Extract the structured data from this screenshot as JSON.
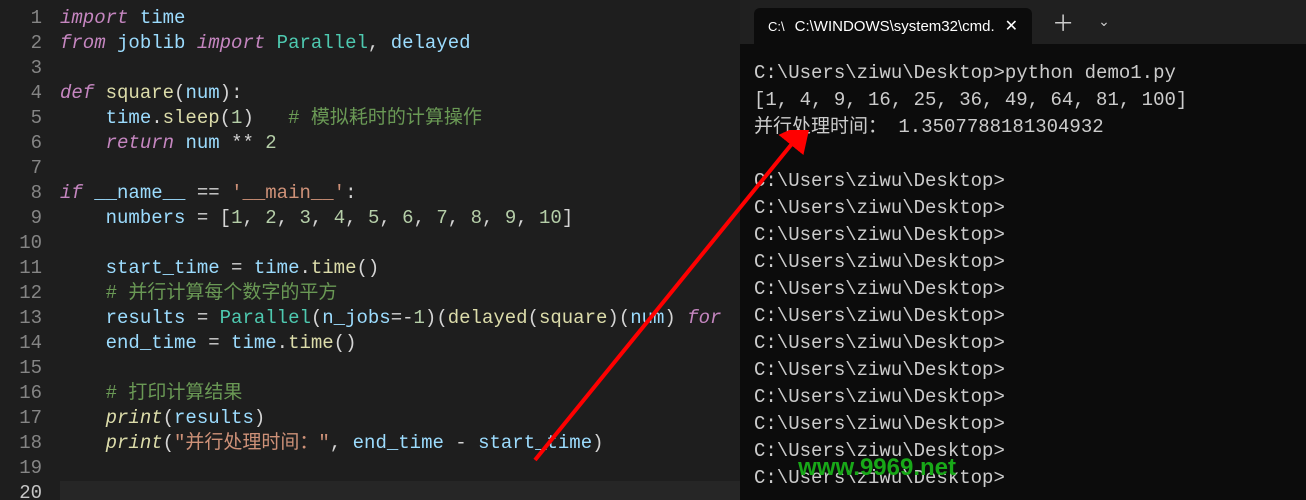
{
  "editor": {
    "line_count": 20,
    "current_line": 20,
    "lines": {
      "l1": [
        {
          "t": "import",
          "c": "kw"
        },
        {
          "t": " "
        },
        {
          "t": "time",
          "c": "var"
        }
      ],
      "l2": [
        {
          "t": "from",
          "c": "kw"
        },
        {
          "t": " "
        },
        {
          "t": "joblib",
          "c": "var"
        },
        {
          "t": " "
        },
        {
          "t": "import",
          "c": "kw"
        },
        {
          "t": " "
        },
        {
          "t": "Parallel",
          "c": "cls"
        },
        {
          "t": ", "
        },
        {
          "t": "delayed",
          "c": "var"
        }
      ],
      "l3": [],
      "l4": [
        {
          "t": "def",
          "c": "kw"
        },
        {
          "t": " "
        },
        {
          "t": "square",
          "c": "fn"
        },
        {
          "t": "(",
          "c": "p"
        },
        {
          "t": "num",
          "c": "var"
        },
        {
          "t": ")",
          "c": "p"
        },
        {
          "t": ":",
          "c": "p"
        }
      ],
      "l5": [
        {
          "t": "    "
        },
        {
          "t": "time",
          "c": "var"
        },
        {
          "t": ".",
          "c": "p"
        },
        {
          "t": "sleep",
          "c": "fn"
        },
        {
          "t": "(",
          "c": "p"
        },
        {
          "t": "1",
          "c": "num"
        },
        {
          "t": ")",
          "c": "p"
        },
        {
          "t": "   "
        },
        {
          "t": "# 模拟耗时的计算操作",
          "c": "cmt"
        }
      ],
      "l6": [
        {
          "t": "    "
        },
        {
          "t": "return",
          "c": "kw"
        },
        {
          "t": " "
        },
        {
          "t": "num",
          "c": "var"
        },
        {
          "t": " "
        },
        {
          "t": "**",
          "c": "op"
        },
        {
          "t": " "
        },
        {
          "t": "2",
          "c": "num"
        }
      ],
      "l7": [],
      "l8": [
        {
          "t": "if",
          "c": "kw"
        },
        {
          "t": " "
        },
        {
          "t": "__name__",
          "c": "dun"
        },
        {
          "t": " "
        },
        {
          "t": "==",
          "c": "op"
        },
        {
          "t": " "
        },
        {
          "t": "'__main__'",
          "c": "str"
        },
        {
          "t": ":",
          "c": "p"
        }
      ],
      "l9": [
        {
          "t": "    "
        },
        {
          "t": "numbers",
          "c": "var"
        },
        {
          "t": " "
        },
        {
          "t": "=",
          "c": "op"
        },
        {
          "t": " ["
        },
        {
          "t": "1",
          "c": "num"
        },
        {
          "t": ", "
        },
        {
          "t": "2",
          "c": "num"
        },
        {
          "t": ", "
        },
        {
          "t": "3",
          "c": "num"
        },
        {
          "t": ", "
        },
        {
          "t": "4",
          "c": "num"
        },
        {
          "t": ", "
        },
        {
          "t": "5",
          "c": "num"
        },
        {
          "t": ", "
        },
        {
          "t": "6",
          "c": "num"
        },
        {
          "t": ", "
        },
        {
          "t": "7",
          "c": "num"
        },
        {
          "t": ", "
        },
        {
          "t": "8",
          "c": "num"
        },
        {
          "t": ", "
        },
        {
          "t": "9",
          "c": "num"
        },
        {
          "t": ", "
        },
        {
          "t": "10",
          "c": "num"
        },
        {
          "t": "]"
        }
      ],
      "l10": [],
      "l11": [
        {
          "t": "    "
        },
        {
          "t": "start_time",
          "c": "var"
        },
        {
          "t": " "
        },
        {
          "t": "=",
          "c": "op"
        },
        {
          "t": " "
        },
        {
          "t": "time",
          "c": "var"
        },
        {
          "t": ".",
          "c": "p"
        },
        {
          "t": "time",
          "c": "fn"
        },
        {
          "t": "()",
          "c": "p"
        }
      ],
      "l12": [
        {
          "t": "    "
        },
        {
          "t": "# 并行计算每个数字的平方",
          "c": "cmt"
        }
      ],
      "l13": [
        {
          "t": "    "
        },
        {
          "t": "results",
          "c": "var"
        },
        {
          "t": " "
        },
        {
          "t": "=",
          "c": "op"
        },
        {
          "t": " "
        },
        {
          "t": "Parallel",
          "c": "cls"
        },
        {
          "t": "(",
          "c": "p"
        },
        {
          "t": "n_jobs",
          "c": "var"
        },
        {
          "t": "=",
          "c": "op"
        },
        {
          "t": "-",
          "c": "op"
        },
        {
          "t": "1",
          "c": "num"
        },
        {
          "t": ")(",
          "c": "p"
        },
        {
          "t": "delayed",
          "c": "fn"
        },
        {
          "t": "(",
          "c": "p"
        },
        {
          "t": "square",
          "c": "fn"
        },
        {
          "t": ")(",
          "c": "p"
        },
        {
          "t": "num",
          "c": "var"
        },
        {
          "t": ") ",
          "c": "p"
        },
        {
          "t": "for",
          "c": "kw"
        }
      ],
      "l14": [
        {
          "t": "    "
        },
        {
          "t": "end_time",
          "c": "var"
        },
        {
          "t": " "
        },
        {
          "t": "=",
          "c": "op"
        },
        {
          "t": " "
        },
        {
          "t": "time",
          "c": "var"
        },
        {
          "t": ".",
          "c": "p"
        },
        {
          "t": "time",
          "c": "fn"
        },
        {
          "t": "()",
          "c": "p"
        }
      ],
      "l15": [],
      "l16": [
        {
          "t": "    "
        },
        {
          "t": "# 打印计算结果",
          "c": "cmt"
        }
      ],
      "l17": [
        {
          "t": "    "
        },
        {
          "t": "print",
          "c": "fni"
        },
        {
          "t": "(",
          "c": "p"
        },
        {
          "t": "results",
          "c": "var"
        },
        {
          "t": ")",
          "c": "p"
        }
      ],
      "l18": [
        {
          "t": "    "
        },
        {
          "t": "print",
          "c": "fni"
        },
        {
          "t": "(",
          "c": "p"
        },
        {
          "t": "\"并行处理时间：\"",
          "c": "str"
        },
        {
          "t": ", "
        },
        {
          "t": "end_time",
          "c": "var"
        },
        {
          "t": " "
        },
        {
          "t": "-",
          "c": "op"
        },
        {
          "t": " "
        },
        {
          "t": "start_time",
          "c": "var"
        },
        {
          "t": ")",
          "c": "p"
        }
      ],
      "l19": [],
      "l20": []
    }
  },
  "terminal": {
    "tab_title": "C:\\WINDOWS\\system32\\cmd.",
    "tab_icon": "C:\\",
    "lines": [
      "C:\\Users\\ziwu\\Desktop>python demo1.py",
      "[1, 4, 9, 16, 25, 36, 49, 64, 81, 100]",
      "并行处理时间： 1.3507788181304932",
      "",
      "C:\\Users\\ziwu\\Desktop>",
      "C:\\Users\\ziwu\\Desktop>",
      "C:\\Users\\ziwu\\Desktop>",
      "C:\\Users\\ziwu\\Desktop>",
      "C:\\Users\\ziwu\\Desktop>",
      "C:\\Users\\ziwu\\Desktop>",
      "C:\\Users\\ziwu\\Desktop>",
      "C:\\Users\\ziwu\\Desktop>",
      "C:\\Users\\ziwu\\Desktop>",
      "C:\\Users\\ziwu\\Desktop>",
      "C:\\Users\\ziwu\\Desktop>",
      "C:\\Users\\ziwu\\Desktop>"
    ]
  },
  "watermark": "www.9969.net",
  "annotation": {
    "arrow_color": "#ff0000"
  }
}
